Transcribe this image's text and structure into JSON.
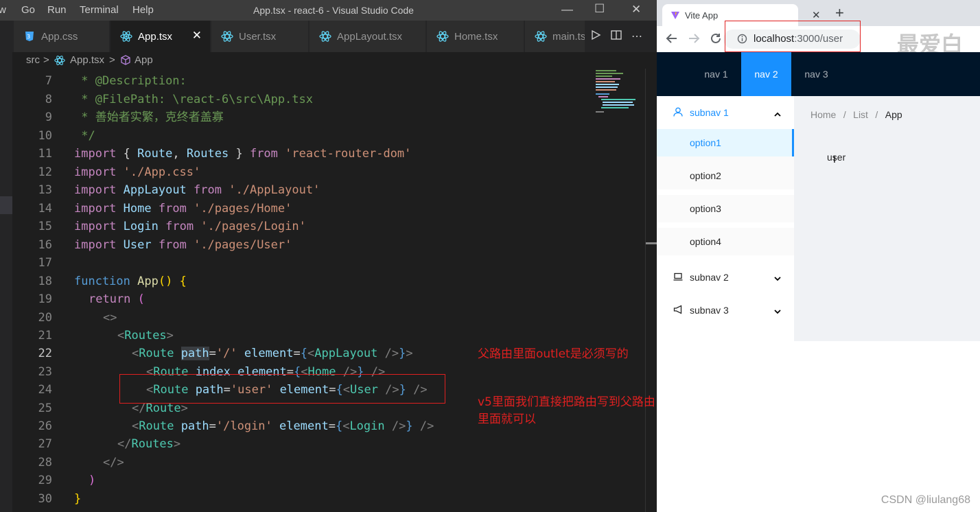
{
  "vscode": {
    "menu": [
      "w",
      "Go",
      "Run",
      "Terminal",
      "Help"
    ],
    "window_title": "App.tsx - react-6 - Visual Studio Code",
    "tabs": [
      {
        "label": "App.css",
        "icon": "css-icon",
        "active": false
      },
      {
        "label": "App.tsx",
        "icon": "react-icon",
        "active": true
      },
      {
        "label": "User.tsx",
        "icon": "react-icon",
        "active": false
      },
      {
        "label": "AppLayout.tsx",
        "icon": "react-icon",
        "active": false
      },
      {
        "label": "Home.tsx",
        "icon": "react-icon",
        "active": false
      },
      {
        "label": "main.ts",
        "icon": "react-icon",
        "active": false
      }
    ],
    "breadcrumb": [
      "src",
      ">",
      "App.tsx",
      ">",
      "App"
    ],
    "lines": [
      "7",
      "8",
      "9",
      "10",
      "11",
      "12",
      "13",
      "14",
      "15",
      "16",
      "17",
      "18",
      "19",
      "20",
      "21",
      "22",
      "23",
      "24",
      "25",
      "26",
      "27",
      "28",
      "29",
      "30"
    ],
    "current_line": "22",
    "code": {
      "l7a": " * ",
      "l7b": "@Description:",
      "l8a": " * ",
      "l8b": "@FilePath: \\react-6\\src\\App.tsx",
      "l9": " * 善始者实繁，克终者盖寡",
      "l10": " */",
      "import": "import",
      "from": "from",
      "l11_mid": " { ",
      "l11_route": "Route",
      ", ": ", ",
      "l11_routes": "Routes",
      "l11_close": " } ",
      "l11_mod": "'react-router-dom'",
      "l12_mod": " './App.css'",
      "l13_id": "AppLayout",
      "l13_mod": "'./AppLayout'",
      "l14_id": "Home",
      "l14_mod": "'./pages/Home'",
      "l15_id": "Login",
      "l15_mod": "'./pages/Login'",
      "l16_id": "User",
      "l16_mod": "'./pages/User'",
      "function": "function",
      "fn_name": "App",
      "paren": "()",
      "brace_open": " {",
      "return": "return",
      "ret_paren": " (",
      "frag_open": "<>",
      "routes_open": "<Routes>",
      "route": "Route",
      "path": "path",
      "element": "element",
      "index": "index",
      "path_root": "'/'",
      "path_user": "'user'",
      "path_login": "'/login'",
      "AppLayout": "AppLayout",
      "Home": "Home",
      "User": "User",
      "Login": "Login",
      "route_close": "</Route>",
      "routes_close": "</Routes>",
      "frag_close": "</>",
      "close_paren": ")",
      "close_brace": "}"
    },
    "annotations": [
      "父路由里面outlet是必须写的",
      "v5里面我们直接把路由写到父路由里面就可以"
    ]
  },
  "browser": {
    "tab_title": "Vite App",
    "new_tab": "+",
    "url_host": "localhost",
    "url_rest": ":3000/user",
    "overlay_text": "最爱白",
    "nav": [
      "nav 1",
      "nav 2",
      "nav 3"
    ],
    "selected_nav": "nav 2",
    "submenus": [
      {
        "label": "subnav 1",
        "icon": "user-icon",
        "open": true,
        "options": [
          "option1",
          "option2",
          "option3",
          "option4"
        ]
      },
      {
        "label": "subnav 2",
        "icon": "laptop-icon",
        "open": false
      },
      {
        "label": "subnav 3",
        "icon": "notification-icon",
        "open": false
      }
    ],
    "selected_option": "option1",
    "breadcrumb": [
      "Home",
      "/",
      "List",
      "/",
      "App"
    ],
    "content_text": "user",
    "watermark": "CSDN @liulang68"
  },
  "colors": {
    "accent": "#1890ff",
    "annotation": "#e02020",
    "header": "#001529"
  }
}
